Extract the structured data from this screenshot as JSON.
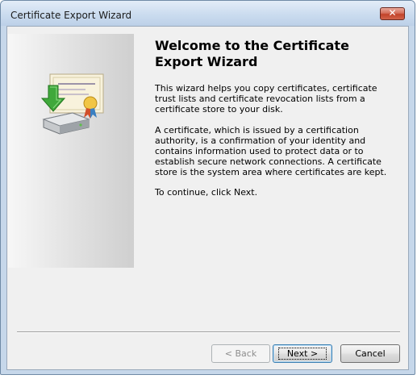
{
  "window": {
    "title": "Certificate Export Wizard",
    "close_label": "✕"
  },
  "wizard": {
    "heading": "Welcome to the Certificate Export Wizard",
    "paragraphs": [
      "This wizard helps you copy certificates, certificate trust lists and certificate revocation lists from a certificate store to your disk.",
      "A certificate, which is issued by a certification authority, is a confirmation of your identity and contains information used to protect data or to establish secure network connections. A certificate store is the system area where certificates are kept.",
      "To continue, click Next."
    ],
    "icon": "certificate-export-icon"
  },
  "buttons": {
    "back": "< Back",
    "next": "Next >",
    "cancel": "Cancel"
  },
  "colors": {
    "close_button": "#c2432a",
    "titlebar": "#cbdcef",
    "client_background": "#f0f0f0"
  }
}
